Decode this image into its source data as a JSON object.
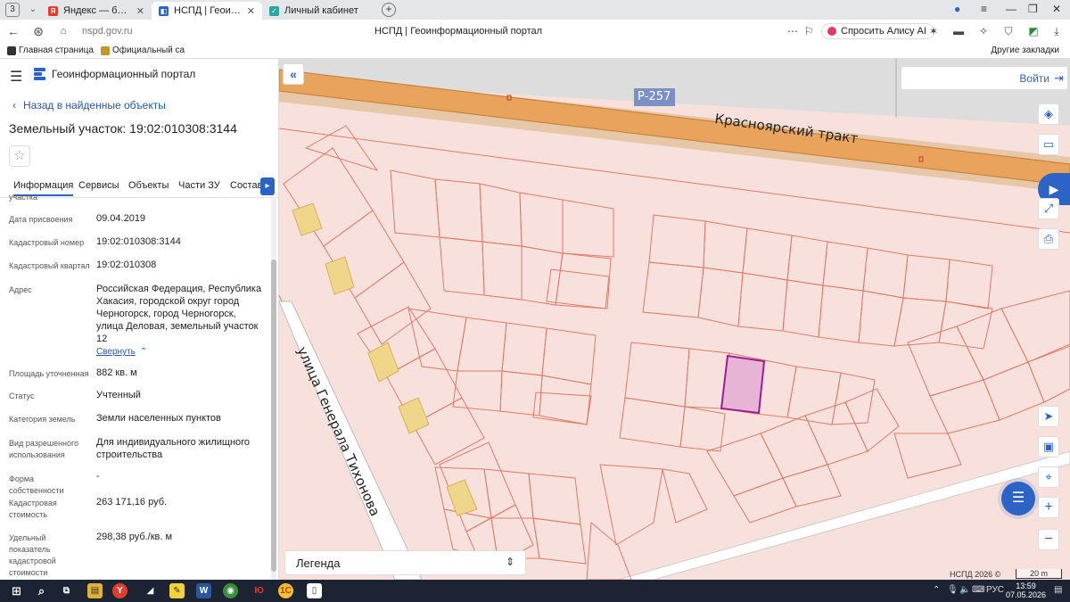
{
  "browser": {
    "tab_count": "3",
    "tabs": [
      {
        "label": "Яндекс — быстрый поиск",
        "favicon": "yandex-icon",
        "color": "#e23c30"
      },
      {
        "label": "НСПД | Геоинформацио",
        "favicon": "nspd-icon",
        "color": "#2c63c4"
      },
      {
        "label": "Личный кабинет",
        "favicon": "cabinet-icon",
        "color": "#2aa5a0"
      }
    ],
    "url": "nspd.gov.ru",
    "page_title": "НСПД | Геоинформационный портал",
    "alice_label": "Спросить Алису AI",
    "bookmarks": [
      {
        "label": "Главная страница"
      },
      {
        "label": "Официальный са"
      }
    ],
    "other_bookmarks": "Другие закладки"
  },
  "panel": {
    "portal_name": "Геоинформационный портал",
    "back_label": "Назад в найденные объекты",
    "title": "Земельный участок: 19:02:010308:3144",
    "tabs": [
      "Информация",
      "Сервисы",
      "Объекты",
      "Части ЗУ",
      "Состав"
    ],
    "cut_label": "участка",
    "props": [
      {
        "key": "Дата присвоения",
        "value": "09.04.2019"
      },
      {
        "key": "Кадастровый номер",
        "value": "19:02:010308:3144"
      },
      {
        "key": "Кадастровый квартал",
        "value": "19:02:010308"
      },
      {
        "key": "Адрес",
        "value": "Российская Федерация, Республика Хакасия, городской округ город Черногорск, город Черногорск, улица Деловая, земельный участок 12"
      },
      {
        "key": "Площадь уточненная",
        "value": "882 кв. м"
      },
      {
        "key": "Статус",
        "value": "Учтенный"
      },
      {
        "key": "Категория земель",
        "value": "Земли населенных пунктов"
      },
      {
        "key": "Вид разрешенного использования",
        "value": "Для индивидуального жилищного строительства"
      },
      {
        "key": "Форма собственности",
        "value": "-"
      },
      {
        "key": "Кадастровая стоимость",
        "value": "263 171,16 руб."
      },
      {
        "key": "Удельный показатель кадастровой стоимости",
        "value": "298,38 руб./кв. м"
      }
    ],
    "collapse_label": "Свернуть"
  },
  "map": {
    "login_label": "Войти",
    "road_code": "Р-257",
    "road_name": "Красноярский тракт",
    "street_name": "улица Генерала Тихонова",
    "legend_label": "Легенда",
    "copyright": "НСПД 2026 ©",
    "scale": "20 m",
    "colors": {
      "parcel_fill": "#f8e1dc",
      "parcel_stroke": "#e07a66",
      "highlight_fill": "#e7b4d6",
      "highlight_stroke": "#9a1f96",
      "road": "#e8a35c",
      "building": "#f0d68a"
    }
  },
  "taskbar": {
    "lang": "РУС",
    "time": "13:59",
    "date": "07.05.2026"
  }
}
